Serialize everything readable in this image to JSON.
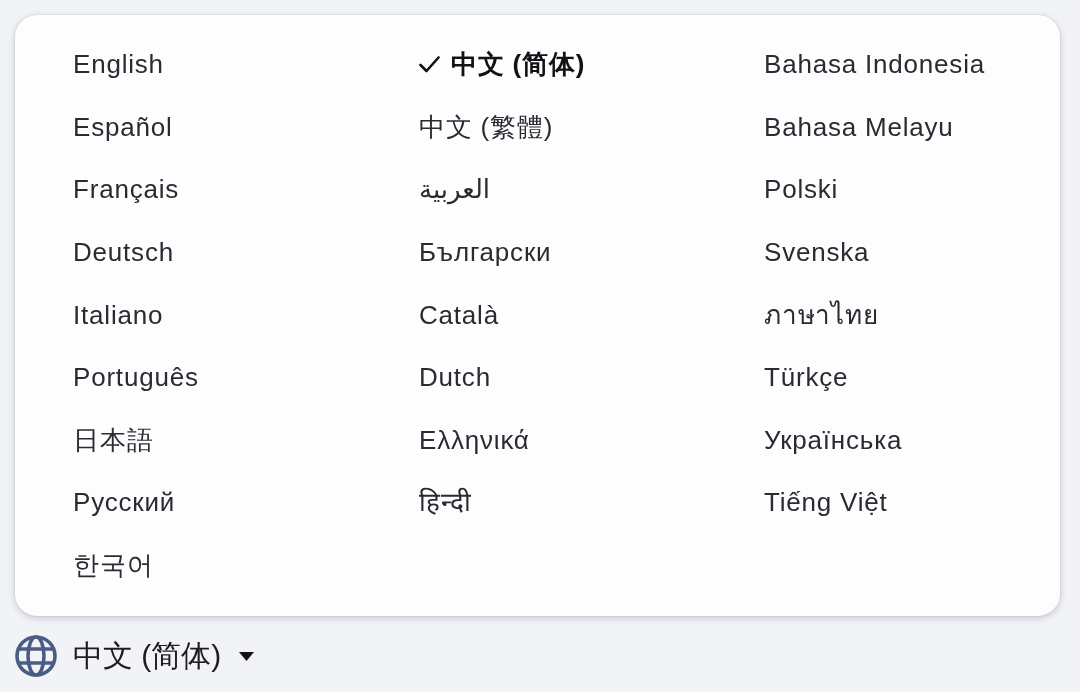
{
  "language_menu": {
    "columns": [
      {
        "options": [
          {
            "label": "English",
            "selected": false
          },
          {
            "label": "Español",
            "selected": false
          },
          {
            "label": "Français",
            "selected": false
          },
          {
            "label": "Deutsch",
            "selected": false
          },
          {
            "label": "Italiano",
            "selected": false
          },
          {
            "label": "Português",
            "selected": false
          },
          {
            "label": "日本語",
            "selected": false
          },
          {
            "label": "Русский",
            "selected": false
          },
          {
            "label": "한국어",
            "selected": false
          }
        ]
      },
      {
        "options": [
          {
            "label": "中文 (简体)",
            "selected": true
          },
          {
            "label": "中文 (繁體)",
            "selected": false
          },
          {
            "label": "العربية",
            "selected": false
          },
          {
            "label": "Български",
            "selected": false
          },
          {
            "label": "Català",
            "selected": false
          },
          {
            "label": "Dutch",
            "selected": false
          },
          {
            "label": "Ελληνικά",
            "selected": false
          },
          {
            "label": "हिन्दी",
            "selected": false
          }
        ]
      },
      {
        "options": [
          {
            "label": "Bahasa Indonesia",
            "selected": false
          },
          {
            "label": "Bahasa Melayu",
            "selected": false
          },
          {
            "label": "Polski",
            "selected": false
          },
          {
            "label": "Svenska",
            "selected": false
          },
          {
            "label": "ภาษาไทย",
            "selected": false
          },
          {
            "label": "Türkçe",
            "selected": false
          },
          {
            "label": "Українська",
            "selected": false
          },
          {
            "label": "Tiếng Việt",
            "selected": false
          }
        ]
      }
    ]
  },
  "language_selector": {
    "label": "中文 (简体)",
    "expanded": true
  }
}
